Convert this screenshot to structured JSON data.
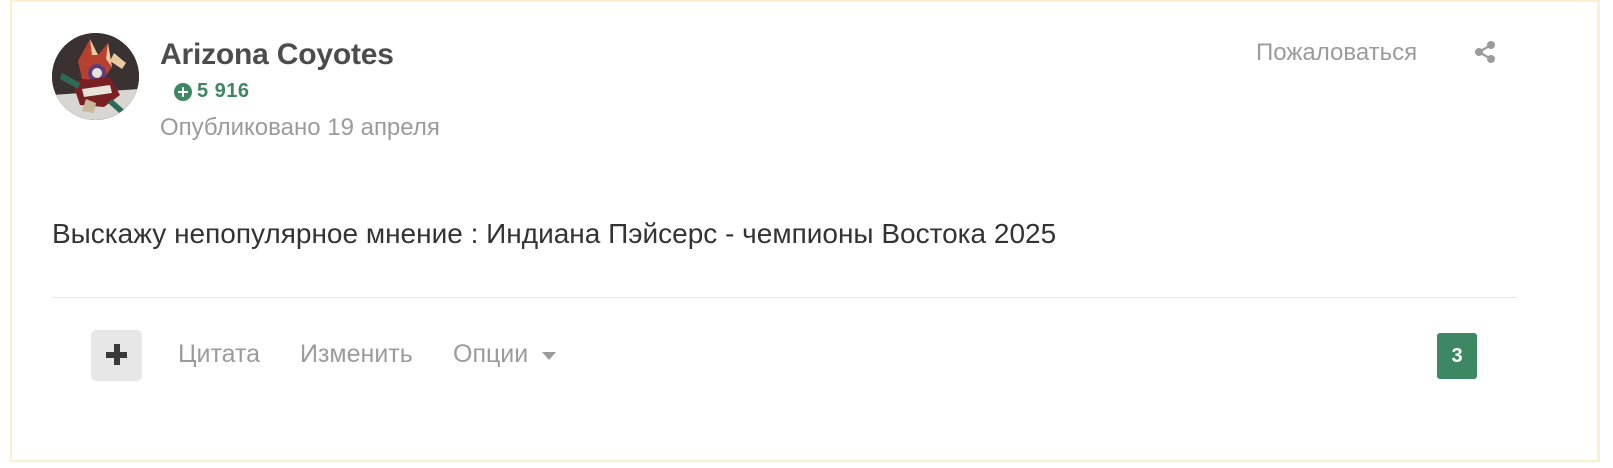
{
  "author": {
    "name": "Arizona Coyotes",
    "reputation": "5 916",
    "published": "Опубликовано 19 апреля"
  },
  "header": {
    "report_label": "Пожаловаться"
  },
  "post": {
    "content": "Выскажу непопулярное мнение : Индиана Пэйсерс - чемпионы Востока 2025"
  },
  "actions": {
    "multiquote_icon": "plus-icon",
    "quote_label": "Цитата",
    "edit_label": "Изменить",
    "options_label": "Опции",
    "reactions_count": "3"
  },
  "colors": {
    "reputation_green": "#3d8762",
    "border": "#fbefcf",
    "muted_text": "#9b9b9b"
  },
  "icons": {
    "share": "share-icon",
    "caret": "caret-down-icon"
  }
}
